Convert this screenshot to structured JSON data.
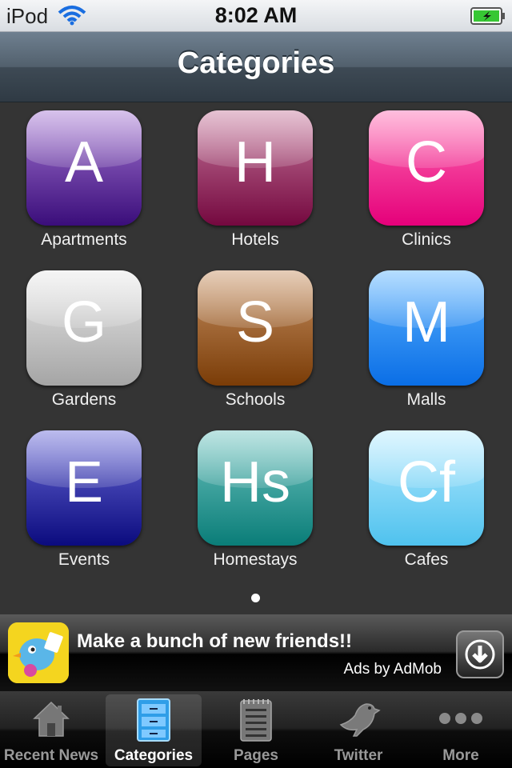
{
  "status_bar": {
    "carrier": "iPod",
    "time": "8:02 AM"
  },
  "nav_bar": {
    "title": "Categories"
  },
  "categories": [
    {
      "letter": "A",
      "label": "Apartments",
      "color_top": "#a678d4",
      "color_bottom": "#3a0d7a"
    },
    {
      "letter": "H",
      "label": "Hotels",
      "color_top": "#c7799d",
      "color_bottom": "#74083f"
    },
    {
      "letter": "C",
      "label": "Clinics",
      "color_top": "#ff6fb4",
      "color_bottom": "#e5007a"
    },
    {
      "letter": "G",
      "label": "Gardens",
      "color_top": "#e8e8e8",
      "color_bottom": "#a5a5a5"
    },
    {
      "letter": "S",
      "label": "Schools",
      "color_top": "#c79163",
      "color_bottom": "#7a3c07"
    },
    {
      "letter": "M",
      "label": "Malls",
      "color_top": "#5db4ff",
      "color_bottom": "#0a6ee6"
    },
    {
      "letter": "E",
      "label": "Events",
      "color_top": "#6a6ad8",
      "color_bottom": "#0b0b7e"
    },
    {
      "letter": "Hs",
      "label": "Homestays",
      "color_top": "#6fc4c0",
      "color_bottom": "#0a7d78"
    },
    {
      "letter": "Cf",
      "label": "Cafes",
      "color_top": "#b6eaff",
      "color_bottom": "#4fc2ee"
    }
  ],
  "ad": {
    "text": "Make a bunch of new friends!!",
    "credit": "Ads by AdMob"
  },
  "tabs": [
    {
      "label": "Recent News",
      "icon": "house-icon",
      "active": false
    },
    {
      "label": "Categories",
      "icon": "filing-cabinet-icon",
      "active": true
    },
    {
      "label": "Pages",
      "icon": "notepad-icon",
      "active": false
    },
    {
      "label": "Twitter",
      "icon": "bird-icon",
      "active": false
    },
    {
      "label": "More",
      "icon": "more-dots-icon",
      "active": false
    }
  ]
}
